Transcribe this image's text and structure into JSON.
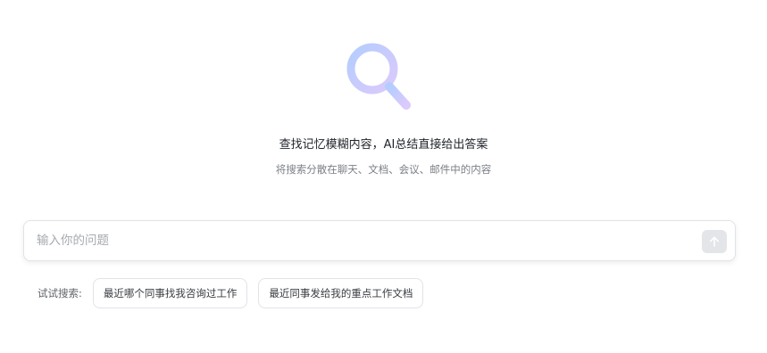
{
  "hero": {
    "icon": "magnifier-icon",
    "title": "查找记忆模糊内容，AI总结直接给出答案",
    "subtitle": "将搜索分散在聊天、文档、会议、邮件中的内容"
  },
  "search": {
    "placeholder": "输入你的问题",
    "value": "",
    "send_icon": "arrow-up-icon"
  },
  "suggestions": {
    "label": "试试搜索:",
    "items": [
      "最近哪个同事找我咨询过工作",
      "最近同事发给我的重点工作文档"
    ]
  },
  "colors": {
    "icon_gradient_start": "#bcd2ff",
    "icon_gradient_end": "#d9c8fb",
    "send_button_bg": "#e4e5e8"
  }
}
